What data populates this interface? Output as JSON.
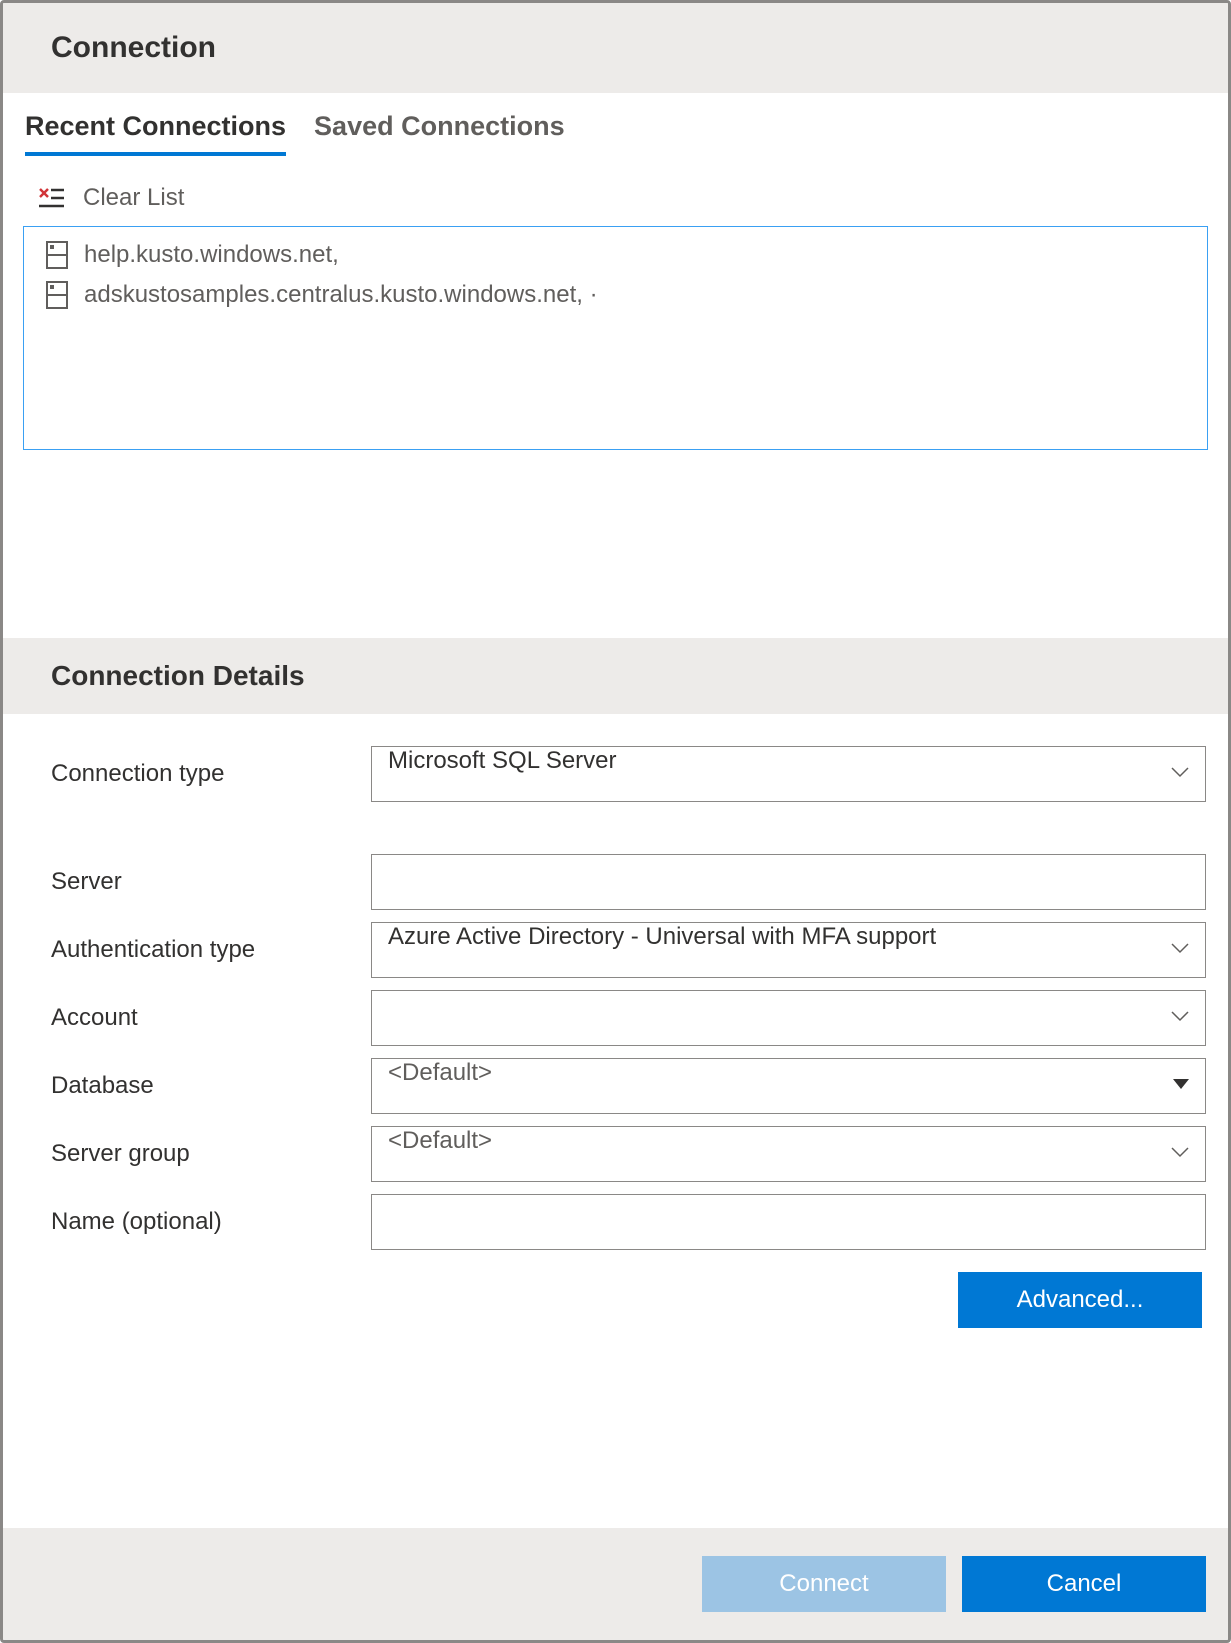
{
  "dialog": {
    "title": "Connection"
  },
  "tabs": {
    "recent": "Recent Connections",
    "saved": "Saved Connections",
    "active": "recent"
  },
  "recent": {
    "clear_label": "Clear List",
    "items": [
      {
        "label": "help.kusto.windows.net,"
      },
      {
        "label": "adskustosamples.centralus.kusto.windows.net, ·"
      }
    ]
  },
  "details": {
    "title": "Connection Details",
    "fields": {
      "connection_type": {
        "label": "Connection type",
        "value": "Microsoft SQL Server"
      },
      "server": {
        "label": "Server",
        "value": ""
      },
      "auth_type": {
        "label": "Authentication type",
        "value": "Azure Active Directory - Universal with MFA support"
      },
      "account": {
        "label": "Account",
        "value": ""
      },
      "database": {
        "label": "Database",
        "value": "<Default>"
      },
      "server_group": {
        "label": "Server group",
        "value": "<Default>"
      },
      "name": {
        "label": "Name (optional)",
        "value": ""
      }
    },
    "advanced_label": "Advanced..."
  },
  "footer": {
    "connect": "Connect",
    "cancel": "Cancel"
  }
}
